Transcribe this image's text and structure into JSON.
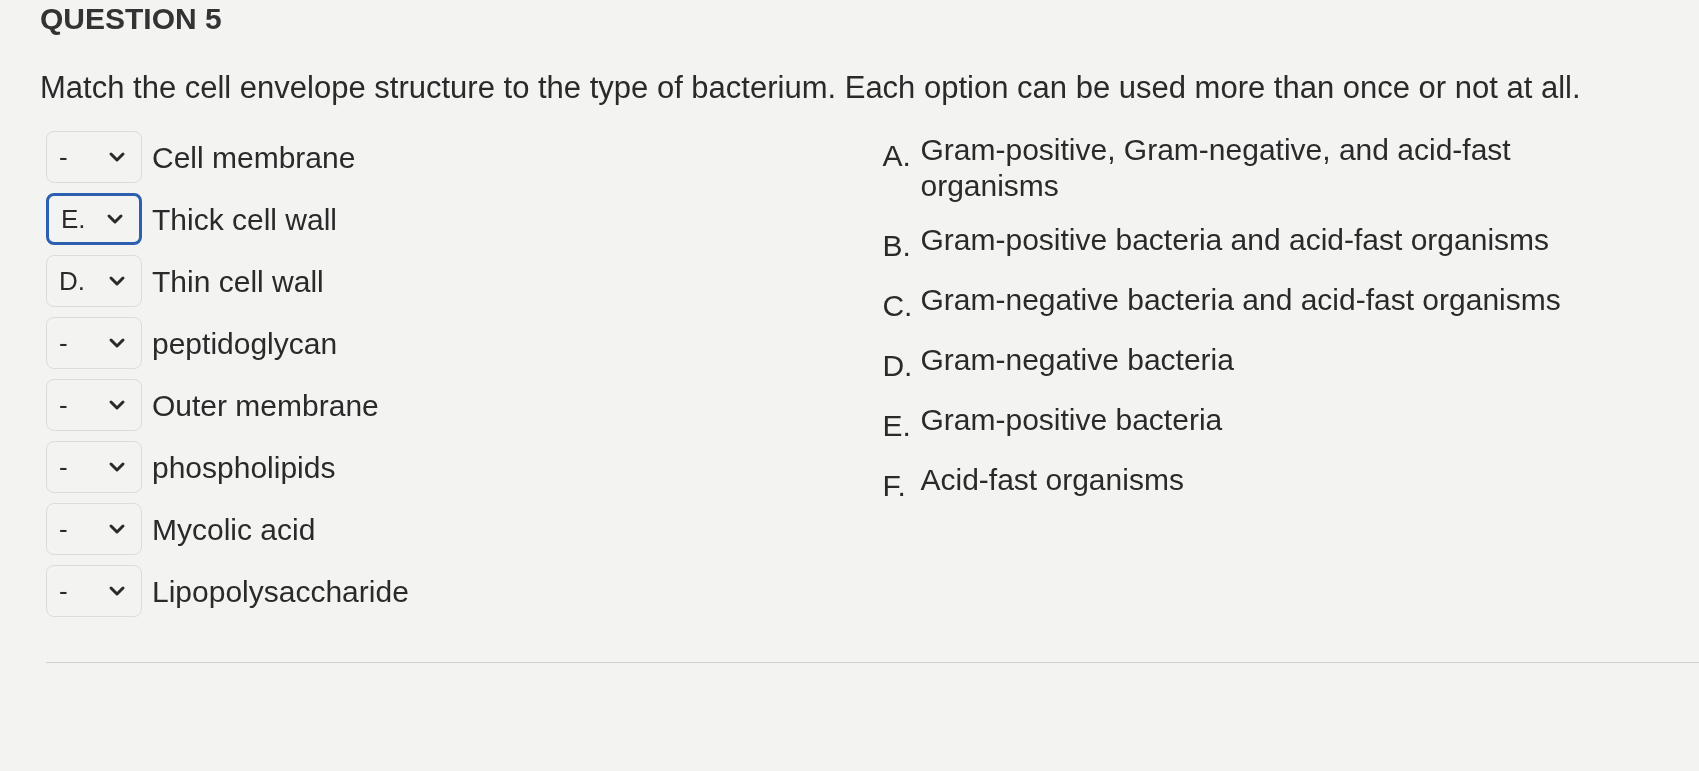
{
  "heading": "QUESTION 5",
  "question": "Match the cell envelope structure to the type of bacterium. Each option can be used more than once or not at all.",
  "matches": [
    {
      "value": "-",
      "focused": false,
      "label": "Cell membrane"
    },
    {
      "value": "E.",
      "focused": true,
      "label": "Thick cell wall"
    },
    {
      "value": "D.",
      "focused": false,
      "label": "Thin cell wall"
    },
    {
      "value": "-",
      "focused": false,
      "label": "peptidoglycan"
    },
    {
      "value": "-",
      "focused": false,
      "label": "Outer membrane"
    },
    {
      "value": "-",
      "focused": false,
      "label": "phospholipids"
    },
    {
      "value": "-",
      "focused": false,
      "label": "Mycolic acid"
    },
    {
      "value": "-",
      "focused": false,
      "label": "Lipopolysaccharide"
    }
  ],
  "options": [
    {
      "letter": "A.",
      "text": "Gram-positive, Gram-negative, and acid-fast organisms"
    },
    {
      "letter": "B.",
      "text": "Gram-positive bacteria and acid-fast organisms"
    },
    {
      "letter": "C.",
      "text": "Gram-negative bacteria and acid-fast organisms"
    },
    {
      "letter": "D.",
      "text": "Gram-negative bacteria"
    },
    {
      "letter": "E.",
      "text": "Gram-positive bacteria"
    },
    {
      "letter": "F.",
      "text": "Acid-fast organisms"
    }
  ]
}
